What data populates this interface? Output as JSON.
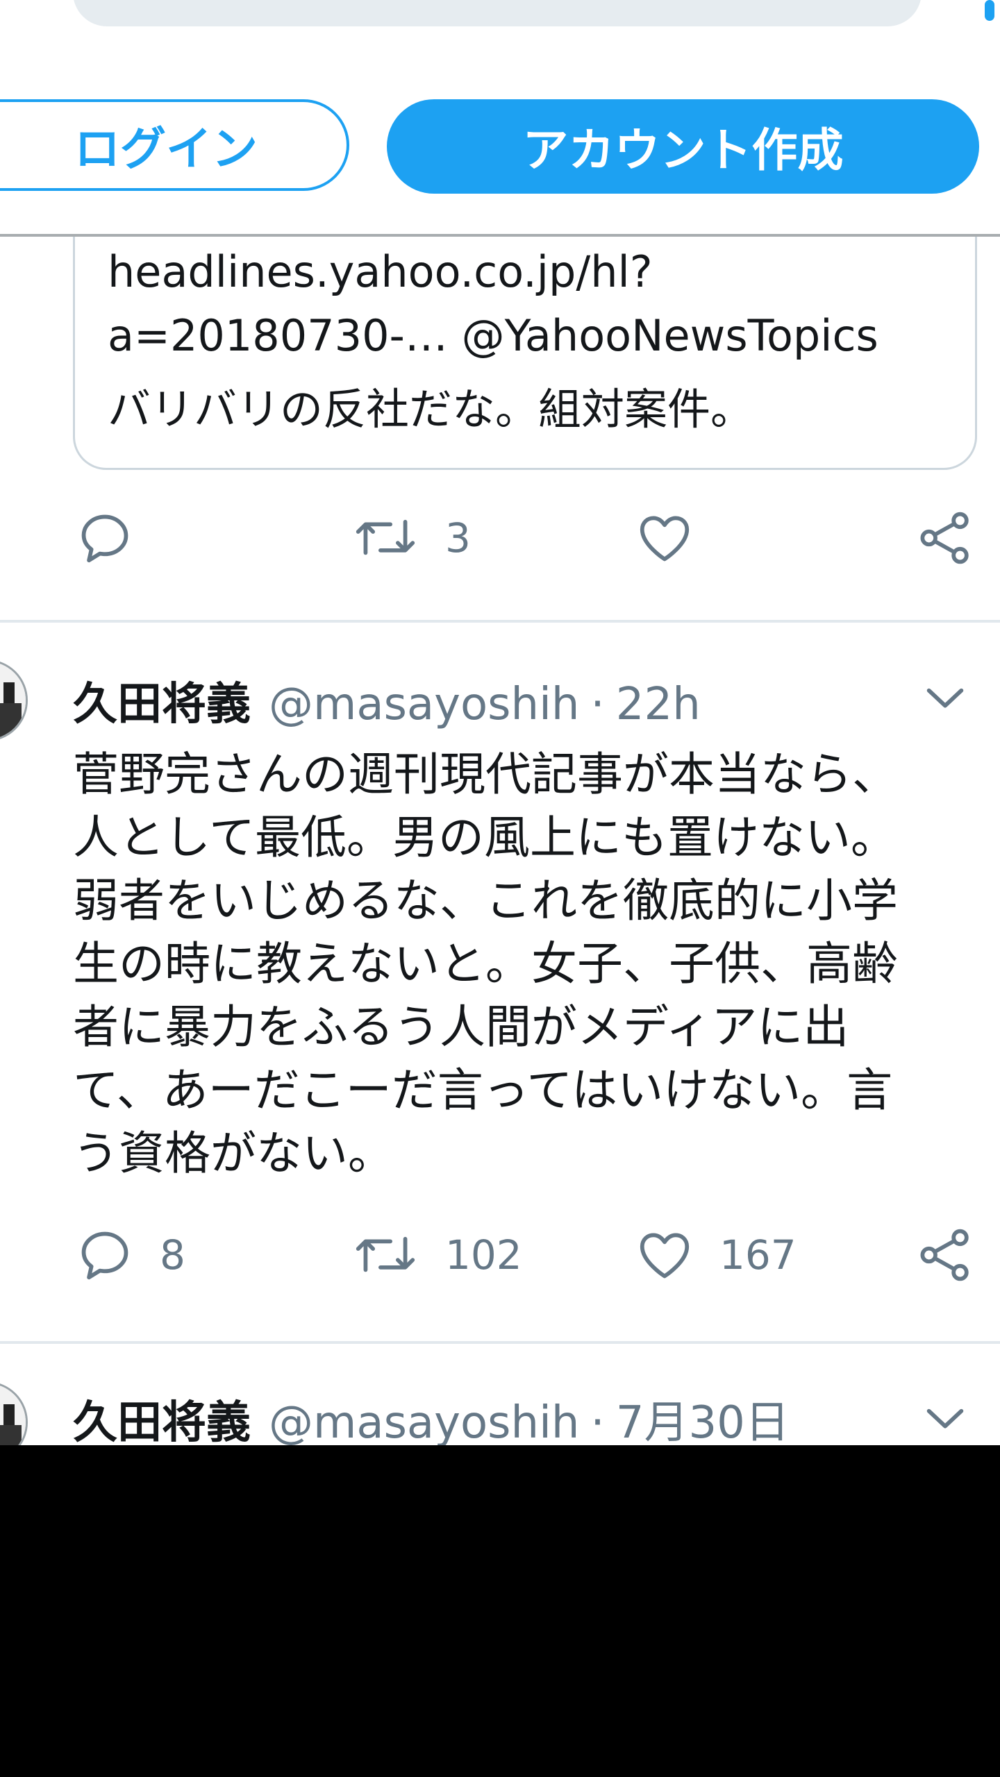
{
  "auth": {
    "login_label": "ログイン",
    "signup_label": "アカウント作成"
  },
  "quote": {
    "lines": [
      "headlines.yahoo.co.jp/hl?",
      "a=20180730-… @YahooNewsTopics",
      "バリバリの反社だな。組対案件。"
    ]
  },
  "tweet0_actions": {
    "reply_count": "",
    "retweet_count": "3",
    "like_count": ""
  },
  "tweets": [
    {
      "name": "久田将義",
      "handle": "@masayoshih",
      "separator": "·",
      "time": "22h",
      "lines": [
        "菅野完さんの週刊現代記事が本当なら、",
        "人として最低。男の風上にも置けない。",
        "弱者をいじめるな、これを徹底的に小学",
        "生の時に教えないと。女子、子供、高齢",
        "者に暴力をふるう人間がメディアに出",
        "て、あーだこーだ言ってはいけない。言",
        "う資格がない。"
      ],
      "reply_count": "8",
      "retweet_count": "102",
      "like_count": "167"
    },
    {
      "name": "久田将義",
      "handle": "@masayoshih",
      "separator": "·",
      "time": "7月30日"
    }
  ],
  "icons": {
    "reply": "reply-icon",
    "retweet": "retweet-icon",
    "like": "heart-icon",
    "share": "share-icon",
    "caret": "chevron-down-icon"
  },
  "colors": {
    "accent": "#1da1f2",
    "muted": "#657786",
    "text": "#14171a",
    "border": "#ccd6dd"
  }
}
